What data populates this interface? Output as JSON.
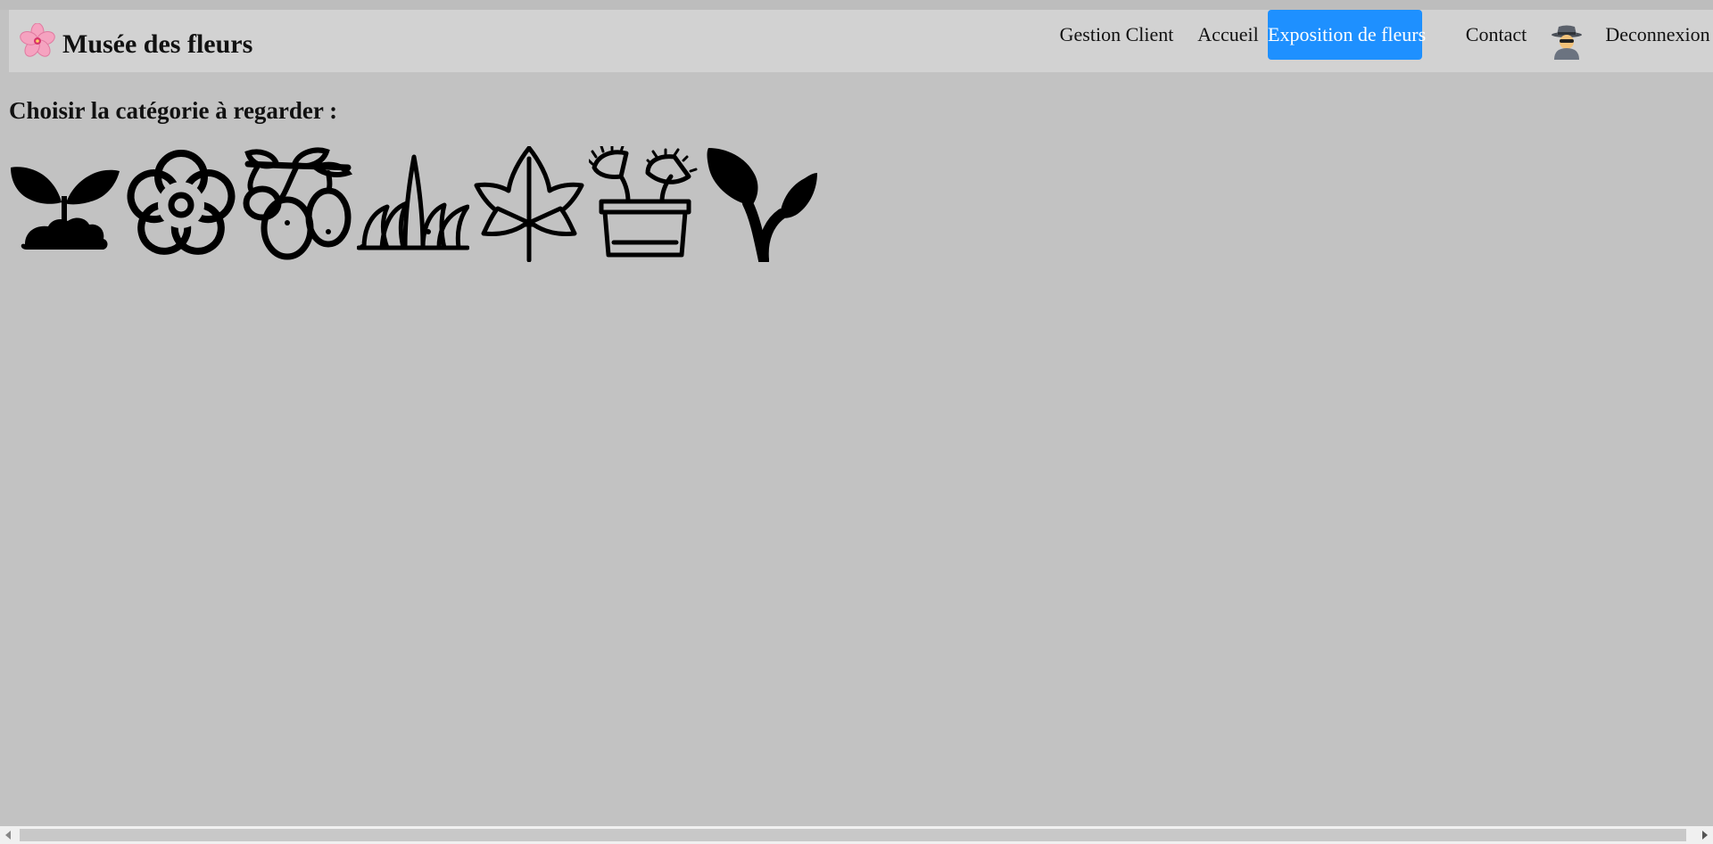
{
  "header": {
    "brand_icon": "cherry-blossom-icon",
    "title": "Musée des fleurs",
    "nav": {
      "gestion_client": "Gestion Client",
      "accueil": "Accueil",
      "exposition": "Exposition de fleurs",
      "contact": "Contact",
      "avatar_icon": "spy-detective-icon",
      "deconnexion": "Deconnexion"
    },
    "active_color": "#1e90ff"
  },
  "main": {
    "heading": "Choisir la catégorie à regarder :",
    "categories": [
      {
        "icon": "sprout-soil-icon"
      },
      {
        "icon": "flower-icon"
      },
      {
        "icon": "olive-branch-icon"
      },
      {
        "icon": "grass-icon"
      },
      {
        "icon": "ivy-leaf-icon"
      },
      {
        "icon": "carnivorous-plant-pot-icon"
      },
      {
        "icon": "plant-sprout-icon"
      }
    ]
  },
  "colors": {
    "page_background": "#c2c2c2",
    "navbar_background": "#d2d2d2"
  }
}
